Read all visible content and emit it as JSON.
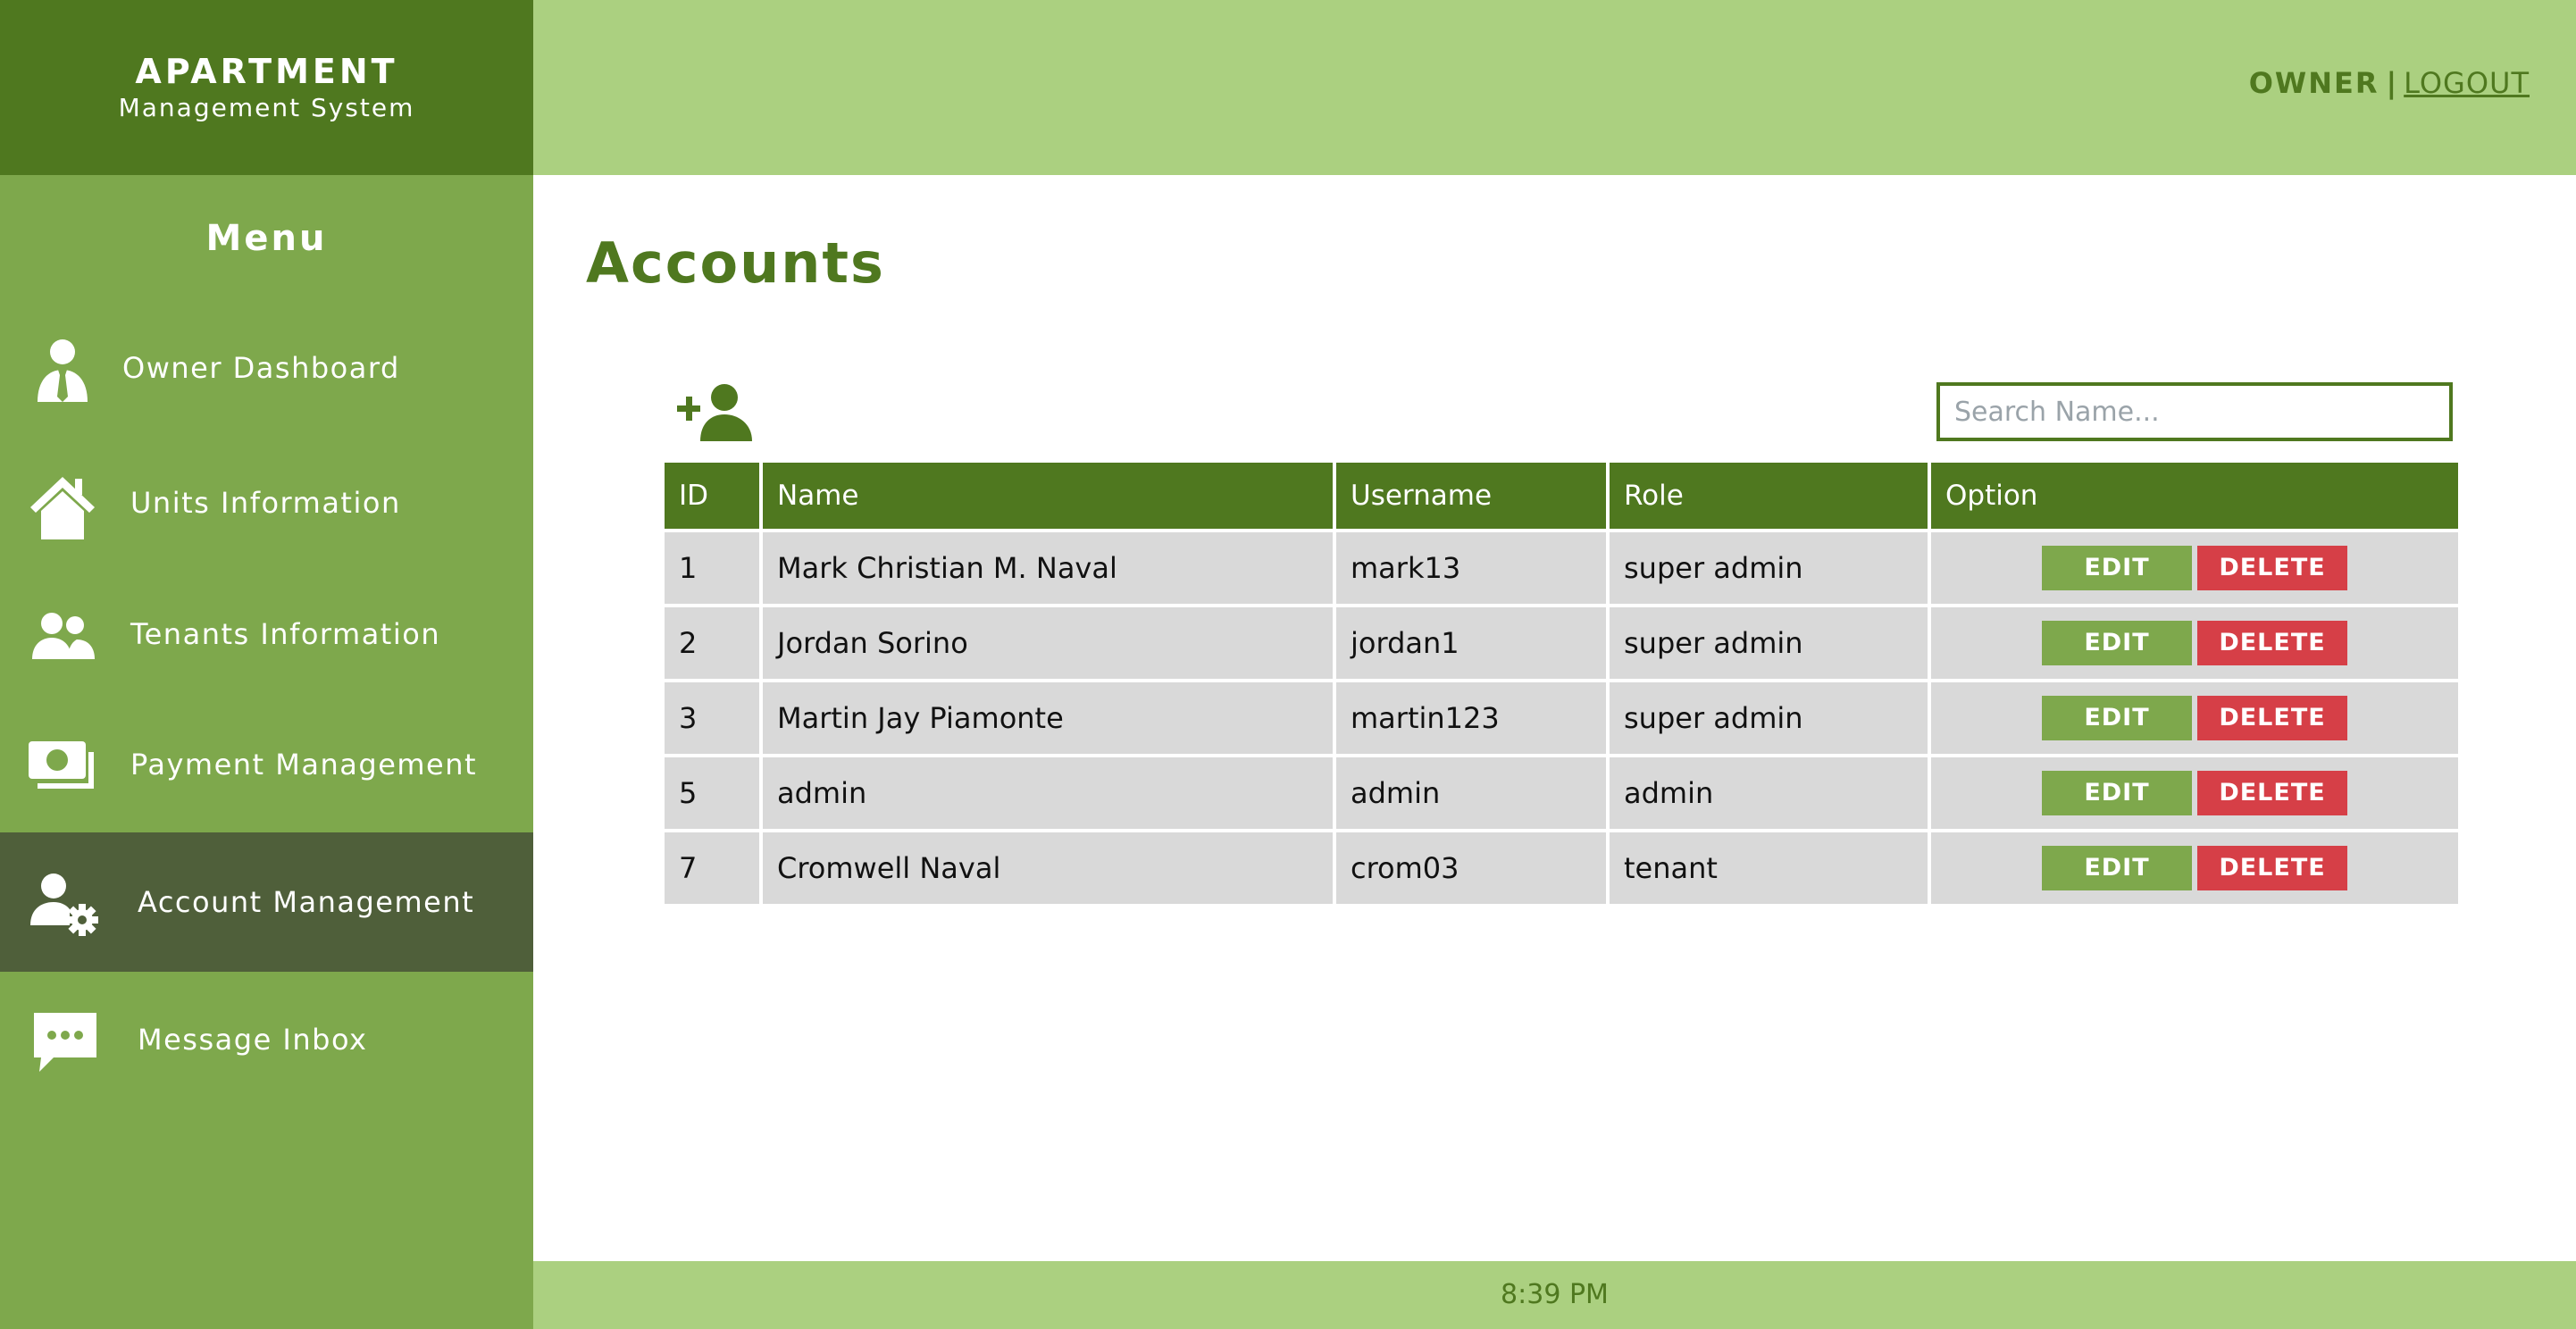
{
  "brand": {
    "title": "APARTMENT",
    "subtitle": "Management System"
  },
  "sidebar": {
    "menu_title": "Menu",
    "items": [
      {
        "label": "Owner Dashboard",
        "icon": "user-tie-icon"
      },
      {
        "label": "Units Information",
        "icon": "house-icon"
      },
      {
        "label": "Tenants Information",
        "icon": "users-icon"
      },
      {
        "label": "Payment Management",
        "icon": "money-bill-icon"
      },
      {
        "label": "Account Management",
        "icon": "user-gear-icon",
        "active": true
      },
      {
        "label": "Message Inbox",
        "icon": "message-dots-icon"
      }
    ]
  },
  "header": {
    "owner_label": "OWNER",
    "separator": "|",
    "logout_label": "LOGOUT"
  },
  "main": {
    "title": "Accounts",
    "add_icon": "add-user-icon",
    "search_placeholder": "Search Name..."
  },
  "table": {
    "columns": [
      "ID",
      "Name",
      "Username",
      "Role",
      "Option"
    ],
    "rows": [
      {
        "id": "1",
        "name": "Mark Christian M. Naval",
        "username": "mark13",
        "role": "super admin"
      },
      {
        "id": "2",
        "name": "Jordan Sorino",
        "username": "jordan1",
        "role": "super admin"
      },
      {
        "id": "3",
        "name": "Martin Jay Piamonte",
        "username": "martin123",
        "role": "super admin"
      },
      {
        "id": "5",
        "name": "admin",
        "username": "admin",
        "role": "admin"
      },
      {
        "id": "7",
        "name": "Cromwell Naval",
        "username": "crom03",
        "role": "tenant"
      }
    ],
    "edit_label": "EDIT",
    "delete_label": "DELETE"
  },
  "footer": {
    "time": "8:39 PM"
  },
  "colors": {
    "primary_dark": "#4f781f",
    "sidebar": "#7ea84c",
    "header_light": "#abd080",
    "active_item": "#4f5f3a",
    "delete": "#d63f47",
    "row_bg": "#d9d9d9"
  }
}
